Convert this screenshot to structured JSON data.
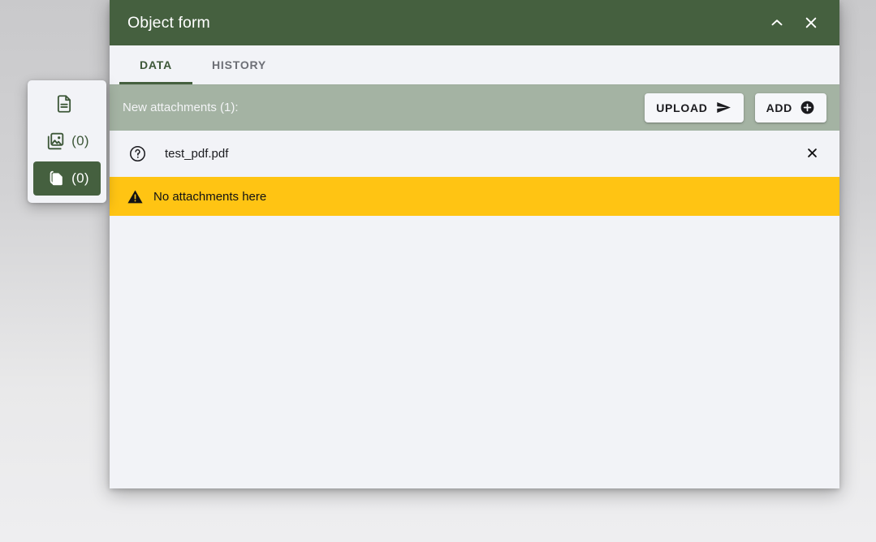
{
  "dialog": {
    "title": "Object form",
    "collapse_icon": "chevron-up-icon",
    "close_icon": "close-icon",
    "tabs": [
      {
        "label": "DATA",
        "active": true
      },
      {
        "label": "HISTORY",
        "active": false
      }
    ]
  },
  "attachments_toolbar": {
    "label": "New attachments (1):",
    "upload_button": {
      "label": "UPLOAD",
      "icon": "send-icon"
    },
    "add_button": {
      "label": "ADD",
      "icon": "add-circle-icon"
    }
  },
  "file_row": {
    "help_icon": "help-circle-icon",
    "name": "test_pdf.pdf",
    "remove_icon": "close-icon"
  },
  "warning": {
    "icon": "warning-triangle-icon",
    "text": "No attachments here"
  },
  "side_panel": {
    "items": [
      {
        "icon": "document-icon",
        "label": "",
        "active": false
      },
      {
        "icon": "photo-library-icon",
        "label": "(0)",
        "active": false
      },
      {
        "icon": "attachment-page-icon",
        "label": "(0)",
        "active": true
      }
    ]
  },
  "colors": {
    "header_green": "#45603f",
    "toolbar_sage": "#a4b3a3",
    "warning_amber": "#ffc413",
    "surface": "#f2f3f7",
    "accent_green": "#3d5738"
  }
}
